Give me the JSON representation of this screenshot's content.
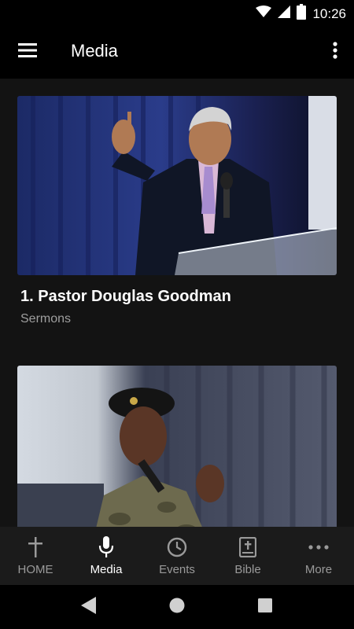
{
  "status_bar": {
    "time": "10:26",
    "icons": [
      "wifi-icon",
      "cell-signal-icon",
      "battery-icon"
    ]
  },
  "app_bar": {
    "title": "Media",
    "menu_icon": "hamburger-menu-icon",
    "overflow_icon": "more-vert-icon"
  },
  "media_list": [
    {
      "title": "1. Pastor Douglas Goodman",
      "subtitle": "Sermons"
    },
    {
      "title": "",
      "subtitle": ""
    }
  ],
  "bottom_nav": {
    "items": [
      {
        "label": "HOME",
        "icon": "cross-icon",
        "active": false
      },
      {
        "label": "Media",
        "icon": "microphone-icon",
        "active": true
      },
      {
        "label": "Events",
        "icon": "clock-icon",
        "active": false
      },
      {
        "label": "Bible",
        "icon": "bible-icon",
        "active": false
      },
      {
        "label": "More",
        "icon": "more-horiz-icon",
        "active": false
      }
    ]
  },
  "system_nav": [
    "back-icon",
    "home-icon",
    "recents-icon"
  ],
  "colors": {
    "background": "#131313",
    "bars": "#000000",
    "bottom_nav": "#1b1b1b",
    "active_label": "#ffffff",
    "inactive_label": "#9a9a9a",
    "subtitle": "#9e9e9e"
  }
}
